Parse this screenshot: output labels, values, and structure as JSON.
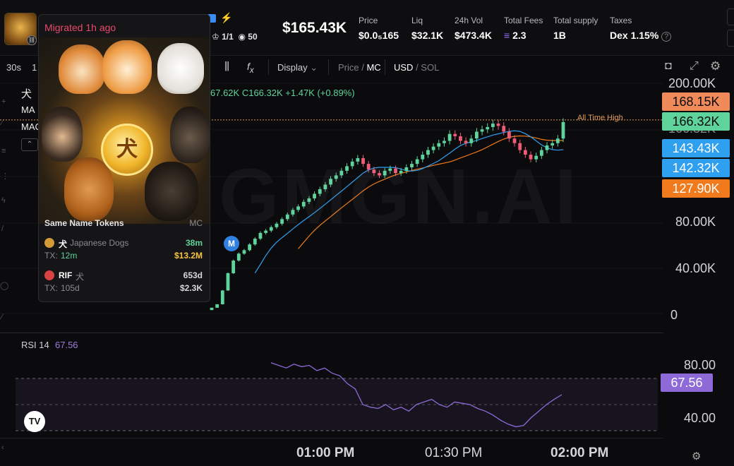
{
  "header": {
    "stats_row": {
      "holders": "1/1",
      "views": "50"
    },
    "market_cap": "$165.43K",
    "stats": [
      {
        "label": "Price",
        "value": "$0.0₅165"
      },
      {
        "label": "Liq",
        "value": "$32.1K"
      },
      {
        "label": "24h Vol",
        "value": "$473.4K"
      },
      {
        "label": "Total Fees",
        "value": "2.3"
      },
      {
        "label": "Total supply",
        "value": "1B"
      },
      {
        "label": "Taxes",
        "value": "Dex 1.15%"
      }
    ]
  },
  "toolbar": {
    "interval_1": "30s",
    "interval_2": "1",
    "display": "Display",
    "price": "Price",
    "mc": "MC",
    "usd": "USD",
    "sol": "SOL"
  },
  "legend": {
    "token_symbol": "犬",
    "ma_label": "MA",
    "mac_label": "MAC",
    "ohlc_tail": "67.62K",
    "close": "C166.32K",
    "change": "+1.47K (+0.89%)"
  },
  "watermark": "GMGN.AI",
  "ath_label": "All Time High",
  "marker_label": "M",
  "colors": {
    "up": "#5ed39b",
    "down": "#f05b75",
    "ma_blue": "#2f9ff0",
    "ma_orange": "#f07a1c",
    "rsi": "#8d6ad8",
    "accent_pink": "#e8496a"
  },
  "chart_data": {
    "type": "candlestick",
    "y_ticks": [
      "200.00K",
      "166.32K",
      "80.00K",
      "40.00K",
      "0"
    ],
    "ylim": [
      0,
      200000
    ],
    "x_ticks": [
      "01:00 PM",
      "01:30 PM",
      "02:00 PM"
    ],
    "price_tags": [
      {
        "value": "168.15K",
        "color": "#f08a5a"
      },
      {
        "value": "166.32K",
        "color": "#5ed39b"
      },
      {
        "value": "143.43K",
        "color": "#2f9ff0"
      },
      {
        "value": "142.32K",
        "color": "#2f9ff0"
      },
      {
        "value": "127.90K",
        "color": "#f07a1c"
      }
    ],
    "close_series": [
      5000,
      8000,
      20000,
      35000,
      46000,
      52000,
      55000,
      60000,
      65000,
      70000,
      72000,
      75000,
      78000,
      82000,
      86000,
      90000,
      93000,
      97000,
      100000,
      104000,
      108000,
      112000,
      117000,
      120000,
      124000,
      128000,
      132000,
      135000,
      130000,
      125000,
      122000,
      120000,
      124000,
      126000,
      122000,
      124000,
      127000,
      130000,
      134000,
      138000,
      142000,
      145000,
      148000,
      150000,
      156000,
      154000,
      150000,
      148000,
      152000,
      158000,
      160000,
      162000,
      165000,
      163000,
      158000,
      152000,
      148000,
      142000,
      138000,
      134000,
      137000,
      142000,
      146000,
      148000,
      152000,
      166320
    ],
    "rsi": {
      "label": "RSI",
      "period": "14",
      "value": "67.56",
      "y_ticks": [
        "80.00",
        "40.00"
      ],
      "series": [
        92,
        90,
        88,
        91,
        89,
        90,
        86,
        88,
        84,
        82,
        76,
        72,
        60,
        58,
        57,
        60,
        56,
        58,
        55,
        60,
        62,
        64,
        60,
        58,
        62,
        61,
        60,
        57,
        55,
        52,
        48,
        45,
        43,
        44,
        50,
        55,
        60,
        64,
        67.56
      ]
    }
  },
  "popup": {
    "title": "Migrated 1h ago",
    "coin_symbol": "犬",
    "section_title": "Same Name Tokens",
    "section_right": "MC",
    "tokens": [
      {
        "symbol": "犬",
        "name": "Japanese Dogs",
        "age": "38m",
        "tx_label": "TX:",
        "tx": "12m",
        "mc": "$13.2M"
      },
      {
        "symbol": "RIF",
        "name": "犬",
        "age": "653d",
        "tx_label": "TX:",
        "tx": "105d",
        "mc": "$2.3K"
      }
    ]
  }
}
